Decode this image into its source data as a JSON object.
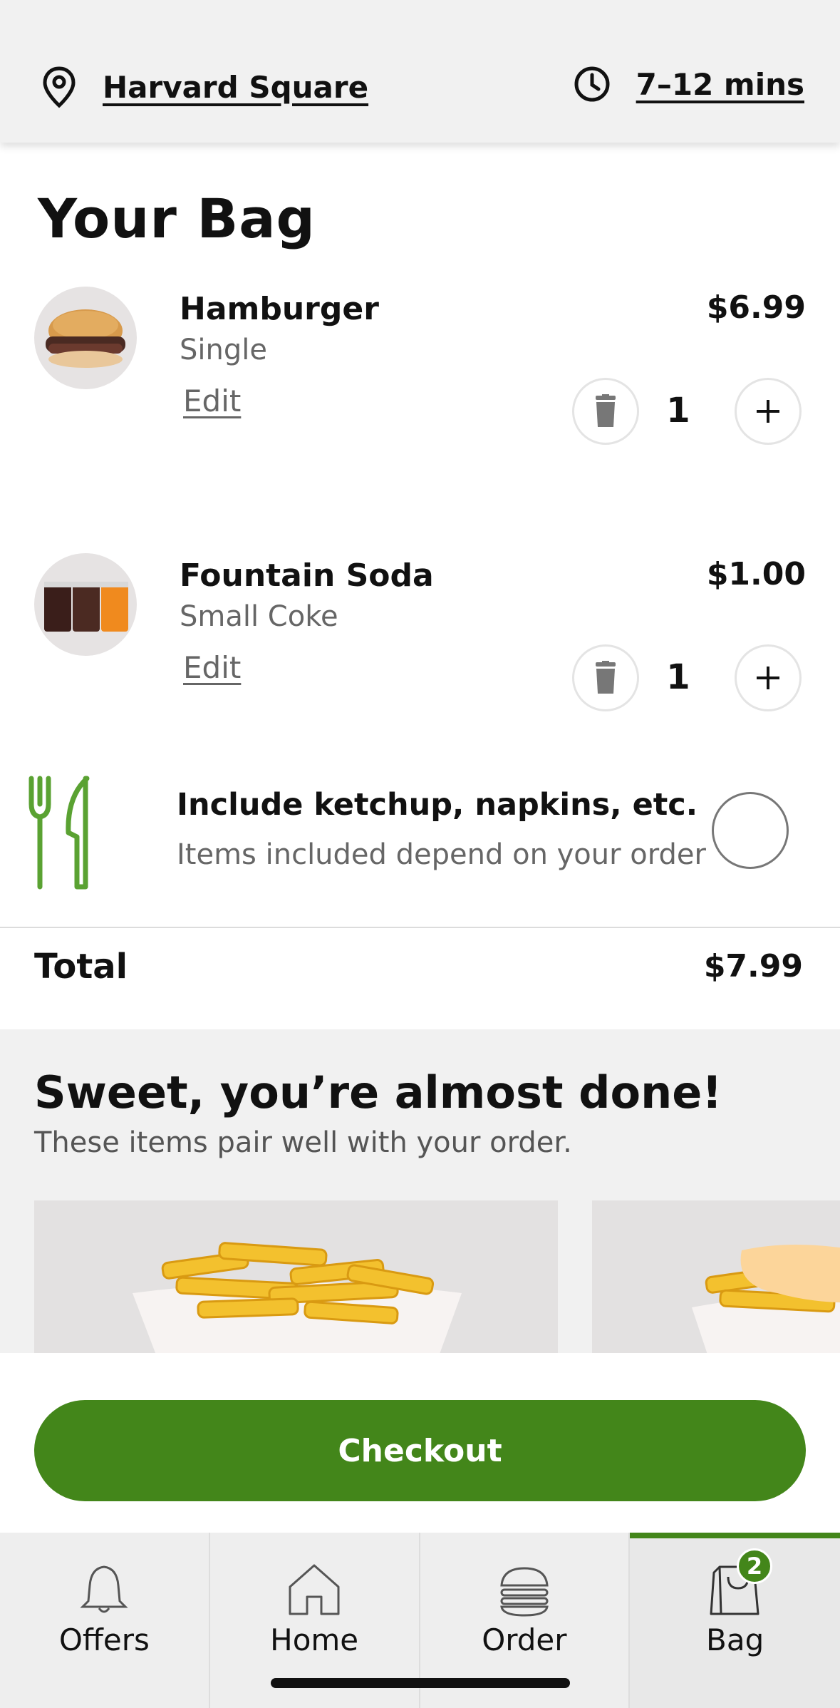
{
  "header": {
    "location": "Harvard Square",
    "eta": "7–12 mins"
  },
  "page_title": "Your Bag",
  "items": [
    {
      "name": "Hamburger",
      "option": "Single",
      "edit_label": "Edit",
      "price": "$6.99",
      "quantity": "1",
      "image": "hamburger"
    },
    {
      "name": "Fountain Soda",
      "option": "Small Coke",
      "edit_label": "Edit",
      "price": "$1.00",
      "quantity": "1",
      "image": "fountain-soda-cups"
    }
  ],
  "condiments": {
    "title": "Include ketchup, napkins, etc.",
    "subtitle": "Items included depend on your order",
    "checked": false,
    "icon": "fork-knife-icon"
  },
  "total": {
    "label": "Total",
    "value": "$7.99"
  },
  "upsell": {
    "title": "Sweet, you’re almost done!",
    "subtitle": "These items pair well with your order.",
    "cards": [
      "fries",
      "cheese-fries"
    ]
  },
  "checkout_label": "Checkout",
  "tabs": [
    {
      "label": "Offers",
      "icon": "bell-icon",
      "active": false
    },
    {
      "label": "Home",
      "icon": "house-icon",
      "active": false
    },
    {
      "label": "Order",
      "icon": "burger-icon",
      "active": false
    },
    {
      "label": "Bag",
      "icon": "bag-icon",
      "active": true
    }
  ],
  "bag_badge": "2",
  "colors": {
    "brand_green": "#43861a",
    "utensil_green": "#5aa232"
  }
}
